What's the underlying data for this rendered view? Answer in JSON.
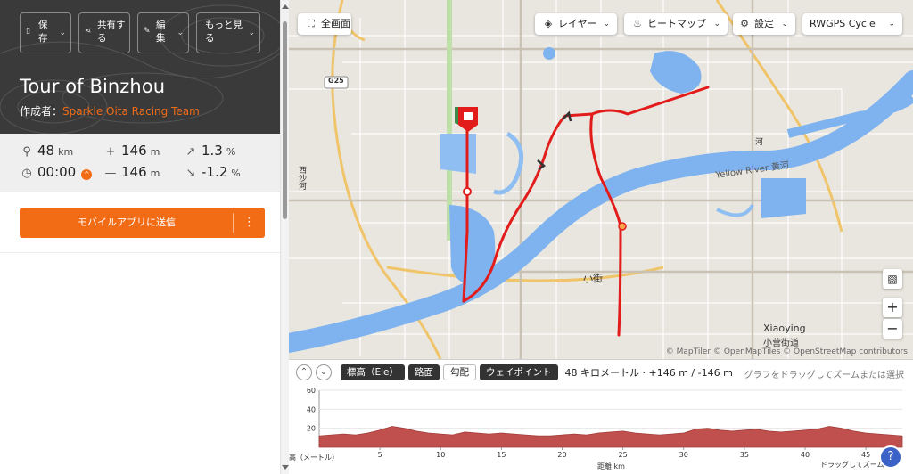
{
  "toolbar": {
    "save": "保存",
    "share": "共有する",
    "edit": "編集",
    "more": "もっと見る"
  },
  "route": {
    "title": "Tour of Binzhou",
    "author_prefix": "作成者：",
    "author": "Sparkle Oita Racing Team"
  },
  "stats": {
    "distance": "48",
    "distance_unit": "km",
    "gain": "146",
    "gain_unit": "m",
    "grade_up": "1.3",
    "grade_up_unit": "%",
    "time": "00:00",
    "loss": "146",
    "loss_unit": "m",
    "grade_down": "-1.2",
    "grade_down_unit": "%"
  },
  "send": {
    "label": "モバイルアプリに送信",
    "more": "⋮"
  },
  "map": {
    "fullscreen": "全画面",
    "layers": "レイヤー",
    "heatmap": "ヒートマップ",
    "settings": "設定",
    "style": "RWGPS Cycle",
    "zoom_in": "+",
    "zoom_out": "−",
    "labels": {
      "g25": "G25",
      "yellow_river": "Yellow River 黄河",
      "xiaojie": "小街",
      "xiaoying": "Xiaoying",
      "xiaoying_jp": "小营街道",
      "xisha_he": "西沙河",
      "river_east": "河"
    },
    "attribution": "© MapTiler © OpenMapTiles © OpenStreetMap contributors"
  },
  "elevation": {
    "tab_elevation": "標高（Ele）",
    "tab_surface": "路面",
    "tab_grade": "勾配",
    "tab_waypoints": "ウェイポイント",
    "summary": "48 キロメートル · +146 m / -146 m",
    "hint": "グラフをドラッグしてズームまたは選択",
    "y_axis_label": "高（メートル）",
    "x_axis_label": "距離 km",
    "bottom_hint": "ドラッグしてズームイン",
    "help": "?"
  },
  "chart_data": {
    "type": "area",
    "xlabel": "距離 km",
    "ylabel": "高（メートル）",
    "x_ticks": [
      5,
      10,
      15,
      20,
      25,
      30,
      35,
      40,
      45
    ],
    "y_ticks": [
      20,
      40,
      60
    ],
    "xlim": [
      0,
      48
    ],
    "ylim": [
      0,
      60
    ],
    "series": [
      {
        "x": [
          0,
          1,
          2,
          3,
          4,
          5,
          6,
          7,
          8,
          9,
          10,
          11,
          12,
          13,
          14,
          15,
          16,
          17,
          18,
          19,
          20,
          21,
          22,
          23,
          24,
          25,
          26,
          27,
          28,
          29,
          30,
          31,
          32,
          33,
          34,
          35,
          36,
          37,
          38,
          39,
          40,
          41,
          42,
          43,
          44,
          45,
          46,
          47,
          48
        ],
        "values": [
          12,
          13,
          14,
          13,
          15,
          18,
          22,
          20,
          17,
          15,
          14,
          13,
          16,
          15,
          14,
          15,
          14,
          13,
          12,
          12,
          13,
          14,
          13,
          15,
          16,
          17,
          15,
          14,
          13,
          14,
          15,
          19,
          20,
          18,
          17,
          18,
          19,
          17,
          16,
          17,
          18,
          19,
          22,
          20,
          17,
          15,
          14,
          13,
          12
        ]
      }
    ],
    "colors": {
      "fill": "#c0504d",
      "stroke": "#a23c39"
    }
  }
}
